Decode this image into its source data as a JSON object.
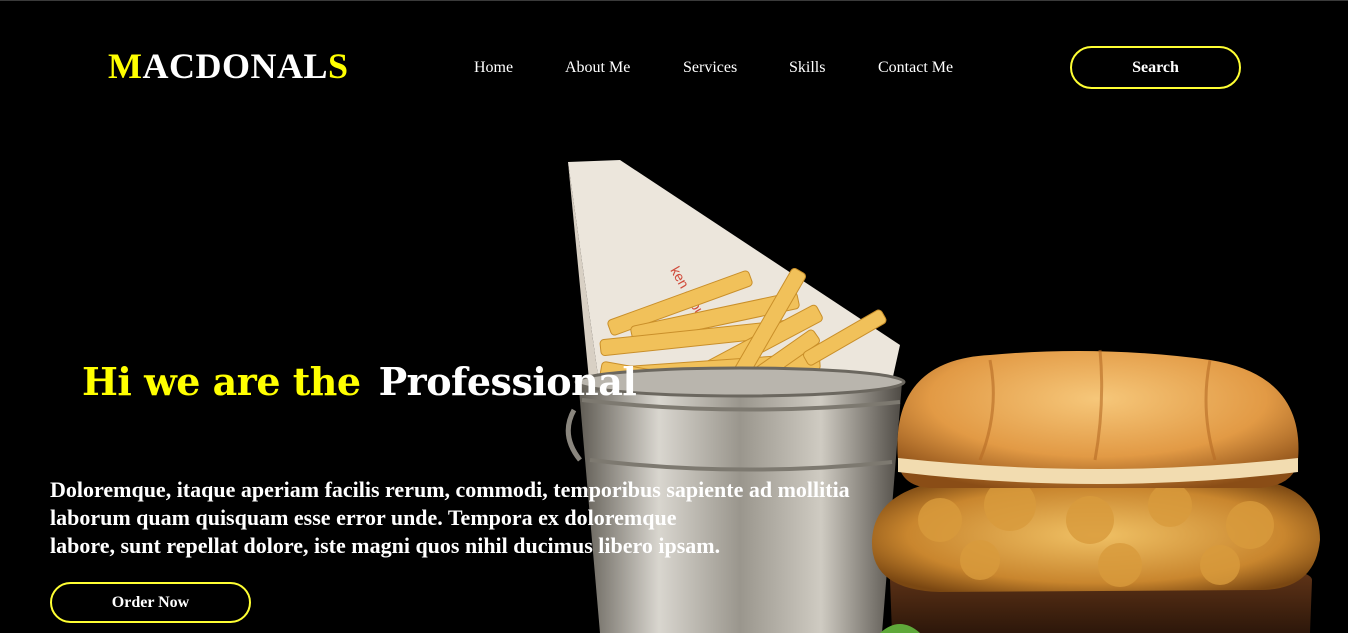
{
  "header": {
    "logo": {
      "first": "M",
      "middle": "ACDONAL",
      "last": "S"
    },
    "nav": [
      {
        "label": "Home"
      },
      {
        "label": "About Me"
      },
      {
        "label": "Services"
      },
      {
        "label": "Skills"
      },
      {
        "label": "Contact Me"
      }
    ],
    "search_label": "Search"
  },
  "hero": {
    "title_highlight": "Hi we are the",
    "title_rest": "Professional",
    "lines": [
      "Doloremque, itaque aperiam facilis rerum, commodi, temporibus sapiente ad mollitia",
      "laborum quam quisquam esse error unde. Tempora ex doloremque",
      "labore, sunt repellat dolore, iste magni quos nihil ducimus libero ipsam."
    ],
    "order_label": "Order Now"
  },
  "colors": {
    "accent": "#ffff00",
    "background": "#000000",
    "text": "#ffffff"
  }
}
